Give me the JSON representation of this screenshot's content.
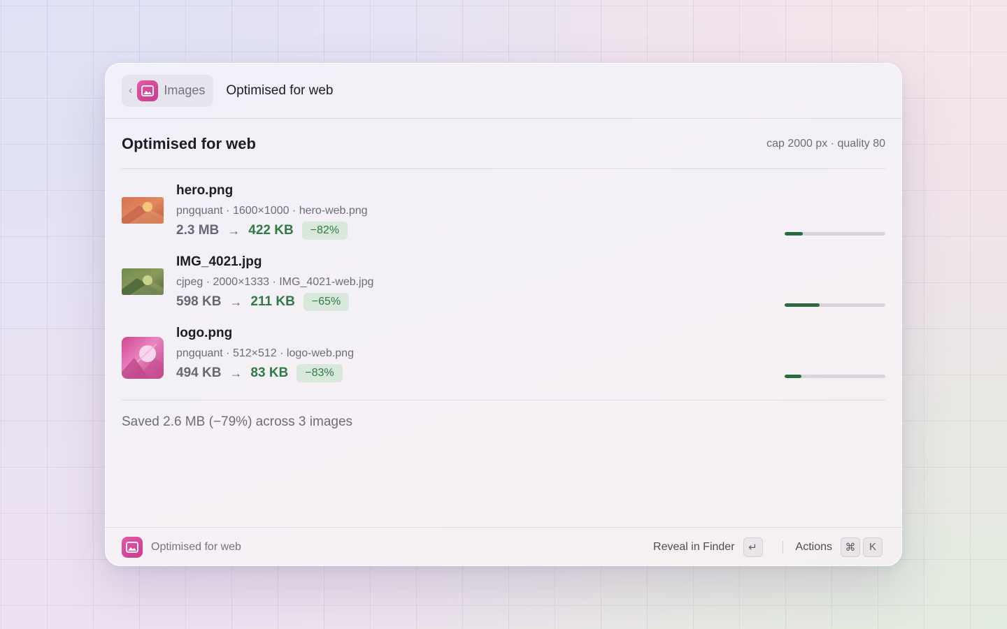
{
  "header": {
    "back_label": "Images",
    "back_chevron": "‹",
    "title": "Optimised for web"
  },
  "section": {
    "title": "Optimised for web",
    "meta": "cap 2000 px · quality 80"
  },
  "items": [
    {
      "name": "hero.png",
      "details": "pngquant · 1600×1000 · hero-web.png",
      "original_size": "2.3 MB",
      "optimised_size": "422 KB",
      "reduction": "−82%",
      "progress": 0.18
    },
    {
      "name": "IMG_4021.jpg",
      "details": "cjpeg · 2000×1333 · IMG_4021-web.jpg",
      "original_size": "598 KB",
      "optimised_size": "211 KB",
      "reduction": "−65%",
      "progress": 0.35
    },
    {
      "name": "logo.png",
      "details": "pngquant · 512×512 · logo-web.png",
      "original_size": "494 KB",
      "optimised_size": "83 KB",
      "reduction": "−83%",
      "progress": 0.17
    }
  ],
  "summary": "Saved 2.6 MB (−79%) across 3 images",
  "footer": {
    "label": "Optimised for web",
    "primary_action": "Reveal in Finder",
    "primary_key": "↵",
    "actions_label": "Actions",
    "actions_keys": [
      "⌘",
      "K"
    ]
  },
  "icons": {
    "app": "image-icon",
    "arrow": "arrow-right-icon"
  },
  "colors": {
    "accent": "#d44c9c",
    "success": "#2f7a45",
    "badge_bg": "#d8e9dc"
  }
}
